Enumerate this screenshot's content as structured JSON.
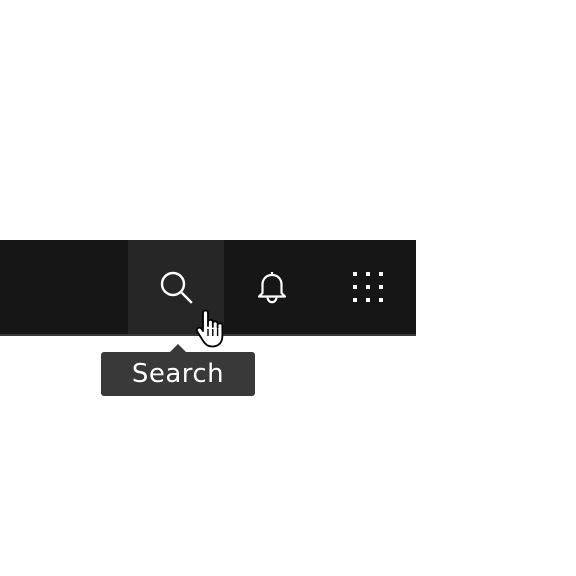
{
  "header": {
    "actions": [
      {
        "name": "search",
        "icon": "search-icon",
        "active": true
      },
      {
        "name": "notifications",
        "icon": "notification-bell-icon",
        "active": false
      },
      {
        "name": "app-switcher",
        "icon": "app-grid-icon",
        "active": false
      }
    ]
  },
  "tooltip": {
    "label": "Search"
  },
  "colors": {
    "header_background": "#161616",
    "active_action_background": "#262626",
    "header_border": "#393939",
    "tooltip_background": "#393939",
    "icon": "#ffffff",
    "page_background": "#ffffff"
  }
}
